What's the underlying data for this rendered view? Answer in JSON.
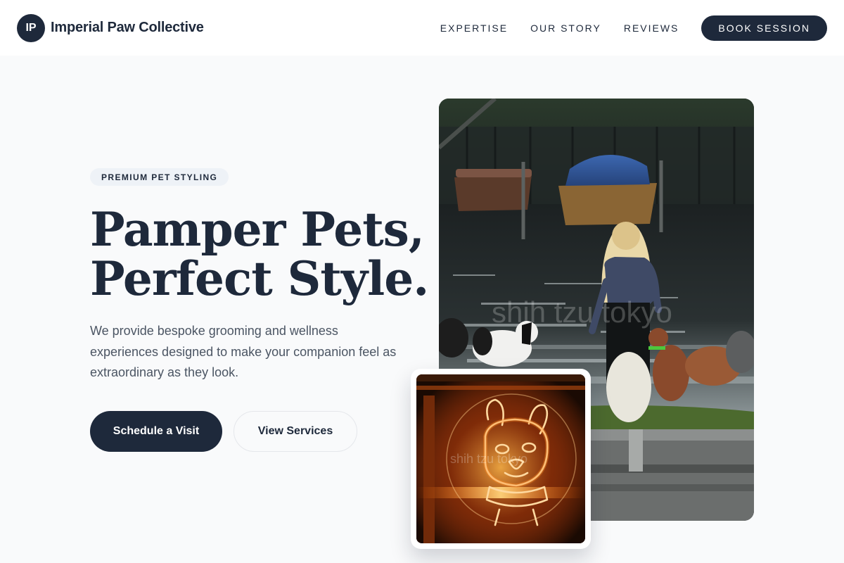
{
  "header": {
    "logo_initials": "IP",
    "brand_name": "Imperial Paw Collective",
    "nav": [
      "EXPERTISE",
      "OUR STORY",
      "REVIEWS"
    ],
    "cta_label": "BOOK SESSION"
  },
  "hero": {
    "eyebrow": "PREMIUM PET STYLING",
    "headline_line1": "Pamper Pets,",
    "headline_line2": "Perfect Style.",
    "description": "We provide bespoke grooming and wellness experiences designed to make your companion feel as extraordinary as they look.",
    "primary_button": "Schedule a Visit",
    "secondary_button": "View Services"
  },
  "photos": {
    "main_watermark": "shih tzu tokyo",
    "neon_watermark": "shih tzu tokyo"
  },
  "colors": {
    "navy": "#1e293b",
    "page_background": "#f9fafb",
    "body_text": "#4b5563",
    "eyebrow_background": "#eef2f7"
  }
}
